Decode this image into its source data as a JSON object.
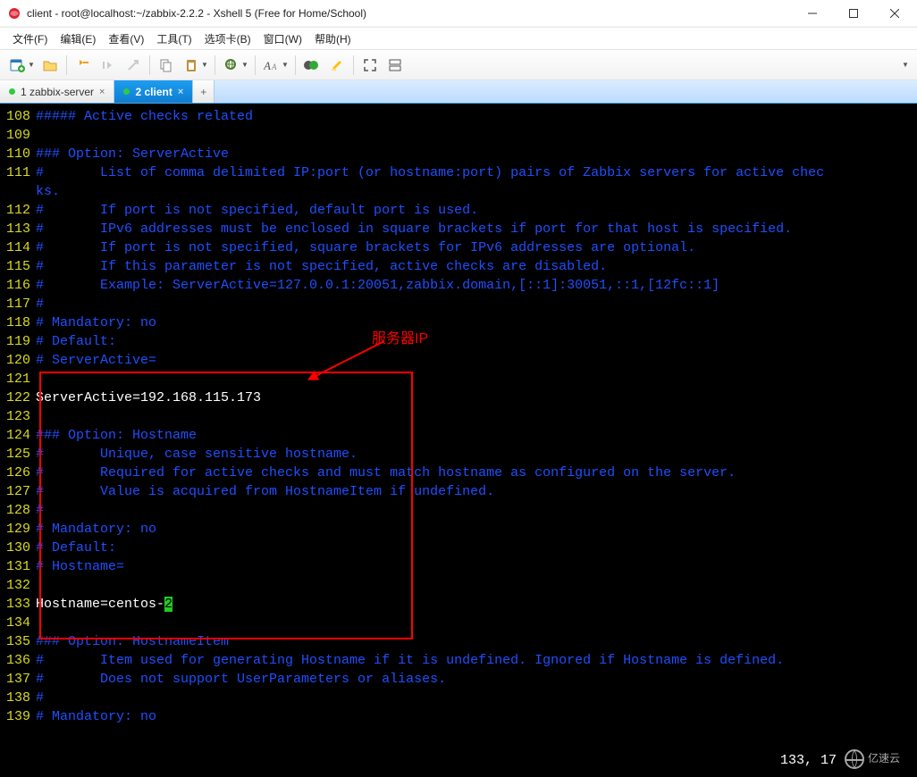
{
  "window": {
    "title": "client - root@localhost:~/zabbix-2.2.2 - Xshell 5 (Free for Home/School)"
  },
  "menu": {
    "file": "文件(F)",
    "edit": "编辑(E)",
    "view": "查看(V)",
    "tools": "工具(T)",
    "tabs": "选项卡(B)",
    "window": "窗口(W)",
    "help": "帮助(H)"
  },
  "tabs": {
    "tab1": "1 zabbix-server",
    "tab2": "2 client",
    "add": "+"
  },
  "annotation": {
    "label": "服务器IP"
  },
  "status": {
    "pos": "133, 17"
  },
  "watermark": {
    "text": "亿速云"
  },
  "lines": [
    {
      "n": "108",
      "t": "##### Active checks related"
    },
    {
      "n": "109",
      "t": ""
    },
    {
      "n": "110",
      "t": "### Option: ServerActive"
    },
    {
      "n": "111",
      "t": "#       List of comma delimited IP:port (or hostname:port) pairs of Zabbix servers for active chec\nks."
    },
    {
      "n": "112",
      "t": "#       If port is not specified, default port is used."
    },
    {
      "n": "113",
      "t": "#       IPv6 addresses must be enclosed in square brackets if port for that host is specified."
    },
    {
      "n": "114",
      "t": "#       If port is not specified, square brackets for IPv6 addresses are optional."
    },
    {
      "n": "115",
      "t": "#       If this parameter is not specified, active checks are disabled."
    },
    {
      "n": "116",
      "t": "#       Example: ServerActive=127.0.0.1:20051,zabbix.domain,[::1]:30051,::1,[12fc::1]"
    },
    {
      "n": "117",
      "t": "#"
    },
    {
      "n": "118",
      "t": "# Mandatory: no"
    },
    {
      "n": "119",
      "t": "# Default:"
    },
    {
      "n": "120",
      "t": "# ServerActive="
    },
    {
      "n": "121",
      "t": ""
    },
    {
      "n": "122",
      "hi": "ServerActive=192.168.115.173"
    },
    {
      "n": "123",
      "t": ""
    },
    {
      "n": "124",
      "t": "### Option: Hostname"
    },
    {
      "n": "125",
      "t": "#       Unique, case sensitive hostname."
    },
    {
      "n": "126",
      "t": "#       Required for active checks and must match hostname as configured on the server."
    },
    {
      "n": "127",
      "t": "#       Value is acquired from HostnameItem if undefined."
    },
    {
      "n": "128",
      "t": "#"
    },
    {
      "n": "129",
      "t": "# Mandatory: no"
    },
    {
      "n": "130",
      "t": "# Default:"
    },
    {
      "n": "131",
      "t": "# Hostname="
    },
    {
      "n": "132",
      "t": ""
    },
    {
      "n": "133",
      "hi": "Hostname=centos-",
      "cur": "2"
    },
    {
      "n": "134",
      "t": ""
    },
    {
      "n": "135",
      "t": "### Option: HostnameItem"
    },
    {
      "n": "136",
      "t": "#       Item used for generating Hostname if it is undefined. Ignored if Hostname is defined."
    },
    {
      "n": "137",
      "t": "#       Does not support UserParameters or aliases."
    },
    {
      "n": "138",
      "t": "#"
    },
    {
      "n": "139",
      "t": "# Mandatory: no"
    }
  ]
}
